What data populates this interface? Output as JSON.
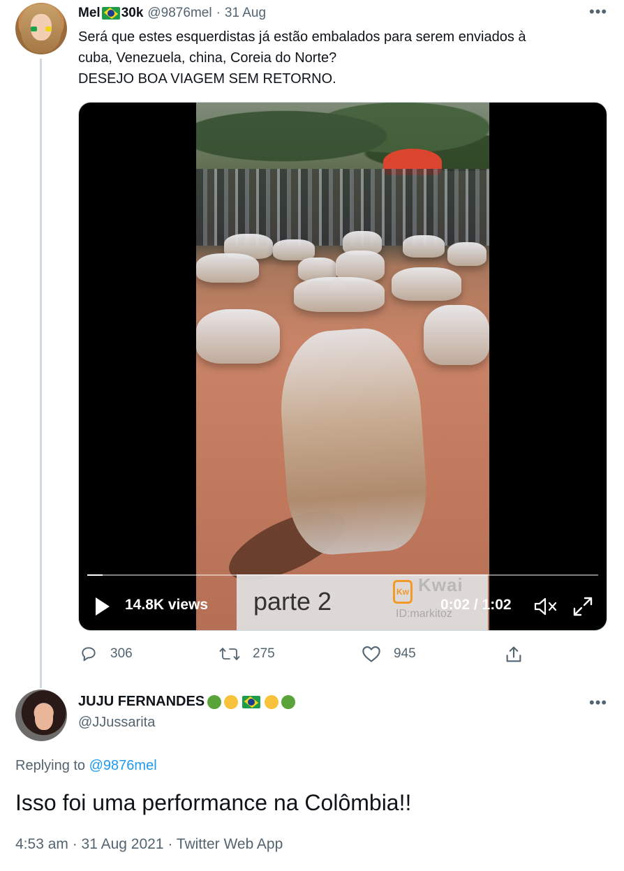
{
  "tweet": {
    "author_name": "Mel",
    "author_suffix": "30k",
    "handle": "@9876mel",
    "separator": "·",
    "date": "31 Aug",
    "text_lines": [
      "Será que estes esquerdistas já estão embalados para serem enviados à",
      "cuba, Venezuela, china, Coreia do Norte?",
      "DESEJO BOA VIAGEM SEM RETORNO."
    ],
    "video": {
      "views": "14.8K views",
      "time": "0:02 / 1:02",
      "progress": 0.03,
      "caption": "parte 2",
      "watermark": "Kwai",
      "watermark_sub": "ID:markitoz",
      "logo_text": "Kw"
    },
    "actions": {
      "replies": "306",
      "retweets": "275",
      "likes": "945"
    }
  },
  "reply": {
    "author_name": "JUJU FERNANDES",
    "handle": "@JJussarita",
    "replying_prefix": "Replying to",
    "replying_mention": "@9876mel",
    "text": "Isso foi uma performance na Colômbia!!",
    "meta": "4:53 am · 31 Aug 2021 · Twitter Web App"
  },
  "colors": {
    "text_primary": "#0f1419",
    "text_secondary": "#536471",
    "link": "#1d9bf0"
  },
  "icons": [
    "more-icon",
    "reply-icon",
    "retweet-icon",
    "like-icon",
    "share-icon",
    "play-icon",
    "mute-icon",
    "fullscreen-icon",
    "brazil-flag-icon",
    "green-heart-icon",
    "yellow-heart-icon"
  ]
}
